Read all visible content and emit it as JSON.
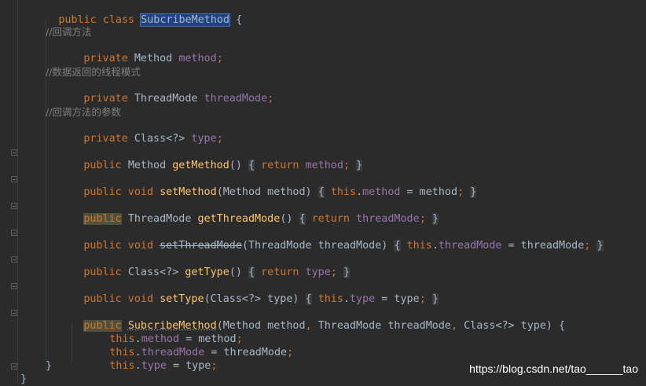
{
  "code": {
    "class_decl": {
      "kw": "public class",
      "name": "SubcribeMethod",
      "brace": "{"
    },
    "c1": "//回调方法",
    "f1": {
      "kw": "private",
      "type": "Method",
      "name": "method",
      "semi": ";"
    },
    "c2": "//数据返回的线程模式",
    "f2": {
      "kw": "private",
      "type": "ThreadMode",
      "name": "threadMode",
      "semi": ";"
    },
    "c3": "//回调方法的参数",
    "f3": {
      "kw": "private",
      "type": "Class<?>",
      "name": "type",
      "semi": ";"
    },
    "m1": {
      "kw": "public",
      "type": "Method",
      "name": "getMethod",
      "paren": "()",
      "open": "{",
      "ret": "return",
      "field": "method",
      "semi": ";",
      "close": "}"
    },
    "m2": {
      "kw": "public void",
      "name": "setMethod",
      "params": "(Method method)",
      "open": "{",
      "this": "this",
      "dot": ".",
      "field": "method",
      "assign": " = method",
      "semi": ";",
      "close": "}"
    },
    "m3": {
      "kw": "public",
      "type": "ThreadMode",
      "name": "getThreadMode",
      "paren": "()",
      "open": "{",
      "ret": "return",
      "field": "threadMode",
      "semi": ";",
      "close": "}"
    },
    "m4": {
      "kw": "public void",
      "name": "setThreadMode",
      "params": "(ThreadMode threadMode)",
      "open": "{",
      "this": "this",
      "dot": ".",
      "field": "threadMode",
      "assign": " = threadMode",
      "semi": ";",
      "close": "}"
    },
    "m5": {
      "kw": "public",
      "type": "Class<?>",
      "name": "getType",
      "paren": "()",
      "open": "{",
      "ret": "return",
      "field": "type",
      "semi": ";",
      "close": "}"
    },
    "m6": {
      "kw": "public void",
      "name": "setType",
      "params": "(Class<?> type)",
      "open": "{",
      "this": "this",
      "dot": ".",
      "field": "type",
      "assign": " = type",
      "semi": ";",
      "close": "}"
    },
    "ctor": {
      "kw": "public",
      "name": "SubcribeMethod",
      "p1": "(Method method",
      "comma": ",",
      "p2": " ThreadMode threadMode",
      "comma2": ",",
      "p3": " Class<?> type) {"
    },
    "b1": {
      "this": "this",
      "dot": ".",
      "field": "method",
      "assign": " = method",
      "semi": ";"
    },
    "b2": {
      "this": "this",
      "dot": ".",
      "field": "threadMode",
      "assign": " = threadMode",
      "semi": ";"
    },
    "b3": {
      "this": "this",
      "dot": ".",
      "field": "type",
      "assign": " = type",
      "semi": ";"
    },
    "ctor_close": "}",
    "class_close": "}"
  },
  "watermark": "https://blog.csdn.net/tao______tao",
  "colors": {
    "background": "#2b2b2b",
    "keyword": "#cc7832",
    "field": "#9876aa",
    "method": "#ffc66d",
    "comment": "#808080",
    "text": "#a9b7c6",
    "selection": "#214283"
  }
}
